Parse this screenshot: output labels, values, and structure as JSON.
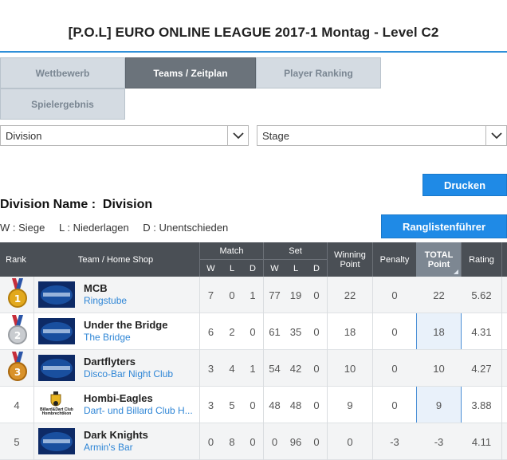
{
  "page": {
    "title": "[P.O.L] EURO ONLINE LEAGUE 2017-1 Montag - Level C2"
  },
  "tabs": [
    {
      "label": "Wettbewerb",
      "active": false
    },
    {
      "label": "Teams / Zeitplan",
      "active": true
    },
    {
      "label": "Player Ranking",
      "active": false
    },
    {
      "label": "Spielergebnis",
      "active": false
    }
  ],
  "filters": {
    "division": {
      "value": "Division"
    },
    "stage": {
      "value": "Stage"
    }
  },
  "buttons": {
    "print": "Drucken",
    "leaders": "Ranglistenführer"
  },
  "division": {
    "label": "Division Name :",
    "value": "Division"
  },
  "legend": {
    "wins": "W : Siege",
    "losses": "L : Niederlagen",
    "draws": "D : Unentschieden"
  },
  "table": {
    "headers": {
      "rank": "Rank",
      "team": "Team / Home Shop",
      "match": "Match",
      "set": "Set",
      "w": "W",
      "l": "L",
      "d": "D",
      "winning_point": "Winning Point",
      "penalty": "Penalty",
      "total_point": "TOTAL Point",
      "rating": "Rating"
    },
    "rows": [
      {
        "rank": "1",
        "medal": "gold",
        "logo": "euro-online-league-logo",
        "team": "MCB",
        "shop": "Ringstube",
        "match": [
          "7",
          "0",
          "1"
        ],
        "set": [
          "77",
          "19",
          "0"
        ],
        "winning": "22",
        "penalty": "0",
        "total": "22",
        "rating": "5.62"
      },
      {
        "rank": "2",
        "medal": "silver",
        "logo": "euro-online-league-logo",
        "team": "Under the Bridge",
        "shop": "The Bridge",
        "match": [
          "6",
          "2",
          "0"
        ],
        "set": [
          "61",
          "35",
          "0"
        ],
        "winning": "18",
        "penalty": "0",
        "total": "18",
        "rating": "4.31"
      },
      {
        "rank": "3",
        "medal": "bronze",
        "logo": "euro-online-league-logo",
        "team": "Dartflyters",
        "shop": "Disco-Bar Night Club",
        "match": [
          "3",
          "4",
          "1"
        ],
        "set": [
          "54",
          "42",
          "0"
        ],
        "winning": "10",
        "penalty": "0",
        "total": "10",
        "rating": "4.27"
      },
      {
        "rank": "4",
        "medal": "",
        "logo": "billard-dart-club-logo",
        "logo_text": "Billard&Dart Club Hombrechtikon",
        "team": "Hombi-Eagles",
        "shop": "Dart- und Billard Club H...",
        "match": [
          "3",
          "5",
          "0"
        ],
        "set": [
          "48",
          "48",
          "0"
        ],
        "winning": "9",
        "penalty": "0",
        "total": "9",
        "rating": "3.88"
      },
      {
        "rank": "5",
        "medal": "",
        "logo": "euro-online-league-logo",
        "team": "Dark Knights",
        "shop": "Armin's Bar",
        "match": [
          "0",
          "8",
          "0"
        ],
        "set": [
          "0",
          "96",
          "0"
        ],
        "winning": "0",
        "penalty": "-3",
        "total": "-3",
        "rating": "4.11"
      }
    ]
  },
  "colors": {
    "accent": "#1f8ae6",
    "header_bg": "#4a4f55",
    "link": "#2f86d6",
    "tab_active": "#6b737b",
    "tab_inactive": "#d4dbe2"
  }
}
